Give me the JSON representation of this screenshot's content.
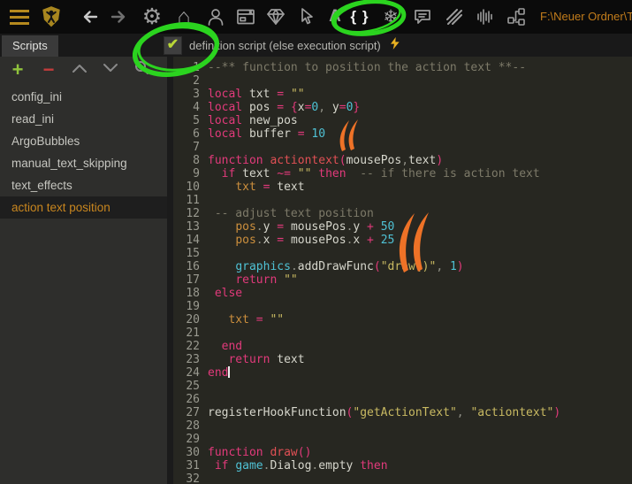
{
  "topbar": {
    "path": "F:\\Neuer Ordner\\T",
    "icons": {
      "gear": "⚙",
      "home": "⌂",
      "snowflake": "❄",
      "letter_a": "A",
      "braces": "{ }"
    }
  },
  "tabbar": {
    "tab_label": "Scripts",
    "checkbox_label": "definition script (else execution script)",
    "check_glyph": "✔",
    "checkbox_checked": true
  },
  "sidebar": {
    "tools": {
      "plus": "+",
      "minus": "−"
    },
    "items": [
      {
        "label": "config_ini",
        "selected": false
      },
      {
        "label": "read_ini",
        "selected": false
      },
      {
        "label": "ArgoBubbles",
        "selected": false
      },
      {
        "label": "manual_text_skipping",
        "selected": false
      },
      {
        "label": "text_effects",
        "selected": false
      },
      {
        "label": "action text position",
        "selected": true
      }
    ]
  },
  "editor": {
    "language": "lua",
    "lines": [
      {
        "n": 1,
        "t": [
          [
            "--** function to position the action text **--",
            "c"
          ]
        ]
      },
      {
        "n": 2,
        "t": []
      },
      {
        "n": 3,
        "t": [
          [
            "local ",
            "k"
          ],
          [
            "txt ",
            "i"
          ],
          [
            "= ",
            "k"
          ],
          [
            "\"\"",
            "s"
          ]
        ]
      },
      {
        "n": 4,
        "t": [
          [
            "local ",
            "k"
          ],
          [
            "pos ",
            "i"
          ],
          [
            "= ",
            "k"
          ],
          [
            "{",
            "k"
          ],
          [
            "x",
            "i"
          ],
          [
            "=",
            "k"
          ],
          [
            "0",
            "n"
          ],
          [
            ", ",
            "p"
          ],
          [
            "y",
            "i"
          ],
          [
            "=",
            "k"
          ],
          [
            "0",
            "n"
          ],
          [
            "}",
            "k"
          ]
        ]
      },
      {
        "n": 5,
        "t": [
          [
            "local ",
            "k"
          ],
          [
            "new_pos",
            "i"
          ]
        ]
      },
      {
        "n": 6,
        "t": [
          [
            "local ",
            "k"
          ],
          [
            "buffer ",
            "i"
          ],
          [
            "= ",
            "k"
          ],
          [
            "10",
            "n"
          ]
        ]
      },
      {
        "n": 7,
        "t": []
      },
      {
        "n": 8,
        "t": [
          [
            "function ",
            "k"
          ],
          [
            "actiontext",
            "f"
          ],
          [
            "(",
            "k"
          ],
          [
            "mousePos",
            "i"
          ],
          [
            ",",
            "p"
          ],
          [
            "text",
            "i"
          ],
          [
            ")",
            "k"
          ]
        ]
      },
      {
        "n": 9,
        "t": [
          [
            "  ",
            "w"
          ],
          [
            "if ",
            "k"
          ],
          [
            "text ",
            "i"
          ],
          [
            "~= ",
            "k"
          ],
          [
            "\"\" ",
            "s"
          ],
          [
            "then",
            "k"
          ],
          [
            "  -- if there is action text",
            "c"
          ]
        ]
      },
      {
        "n": 10,
        "t": [
          [
            "    ",
            "w"
          ],
          [
            "txt ",
            "g"
          ],
          [
            "= ",
            "k"
          ],
          [
            "text",
            "i"
          ]
        ]
      },
      {
        "n": 11,
        "t": []
      },
      {
        "n": 12,
        "t": [
          [
            " -- adjust text position",
            "c"
          ]
        ]
      },
      {
        "n": 13,
        "t": [
          [
            "    ",
            "w"
          ],
          [
            "pos",
            "g"
          ],
          [
            ".",
            "p"
          ],
          [
            "y ",
            "i"
          ],
          [
            "= ",
            "k"
          ],
          [
            "mousePos",
            "i"
          ],
          [
            ".",
            "p"
          ],
          [
            "y ",
            "i"
          ],
          [
            "+ ",
            "k"
          ],
          [
            "50",
            "n"
          ]
        ]
      },
      {
        "n": 14,
        "t": [
          [
            "    ",
            "w"
          ],
          [
            "pos",
            "g"
          ],
          [
            ".",
            "p"
          ],
          [
            "x ",
            "i"
          ],
          [
            "= ",
            "k"
          ],
          [
            "mousePos",
            "i"
          ],
          [
            ".",
            "p"
          ],
          [
            "x ",
            "i"
          ],
          [
            "+ ",
            "k"
          ],
          [
            "25",
            "n"
          ]
        ]
      },
      {
        "n": 15,
        "t": []
      },
      {
        "n": 16,
        "t": [
          [
            "    ",
            "w"
          ],
          [
            "graphics",
            "b"
          ],
          [
            ".",
            "p"
          ],
          [
            "addDrawFunc",
            "i"
          ],
          [
            "(",
            "k"
          ],
          [
            "\"draw()\"",
            "s"
          ],
          [
            ",",
            "p"
          ],
          [
            " ",
            "w"
          ],
          [
            "1",
            "n"
          ],
          [
            ")",
            "k"
          ]
        ]
      },
      {
        "n": 17,
        "t": [
          [
            "    ",
            "w"
          ],
          [
            "return ",
            "k"
          ],
          [
            "\"\"",
            "s"
          ]
        ]
      },
      {
        "n": 18,
        "t": [
          [
            " ",
            "w"
          ],
          [
            "else",
            "k"
          ]
        ]
      },
      {
        "n": 19,
        "t": []
      },
      {
        "n": 20,
        "t": [
          [
            "   ",
            "w"
          ],
          [
            "txt ",
            "g"
          ],
          [
            "= ",
            "k"
          ],
          [
            "\"\"",
            "s"
          ]
        ]
      },
      {
        "n": 21,
        "t": []
      },
      {
        "n": 22,
        "t": [
          [
            "  ",
            "w"
          ],
          [
            "end",
            "k"
          ]
        ]
      },
      {
        "n": 23,
        "t": [
          [
            "   ",
            "w"
          ],
          [
            "return ",
            "k"
          ],
          [
            "text",
            "i"
          ]
        ]
      },
      {
        "n": 24,
        "t": [
          [
            "end",
            "k"
          ]
        ],
        "cursor": true
      },
      {
        "n": 25,
        "t": []
      },
      {
        "n": 26,
        "t": []
      },
      {
        "n": 27,
        "t": [
          [
            "registerHookFunction",
            "i"
          ],
          [
            "(",
            "k"
          ],
          [
            "\"getActionText\"",
            "s"
          ],
          [
            ",",
            "p"
          ],
          [
            " ",
            "w"
          ],
          [
            "\"actiontext\"",
            "s"
          ],
          [
            ")",
            "k"
          ]
        ]
      },
      {
        "n": 28,
        "t": []
      },
      {
        "n": 29,
        "t": []
      },
      {
        "n": 30,
        "t": [
          [
            "function ",
            "k"
          ],
          [
            "draw",
            "f"
          ],
          [
            "()",
            "k"
          ]
        ]
      },
      {
        "n": 31,
        "t": [
          [
            " ",
            "w"
          ],
          [
            "if ",
            "k"
          ],
          [
            "game",
            "b"
          ],
          [
            ".",
            "p"
          ],
          [
            "Dialog",
            "i"
          ],
          [
            ".",
            "p"
          ],
          [
            "empty ",
            "i"
          ],
          [
            "then",
            "k"
          ]
        ]
      },
      {
        "n": 32,
        "t": []
      }
    ]
  },
  "colors": {
    "annotation_green": "#2bd41f",
    "annotation_orange": "#ee7227",
    "accent_gold": "#b5891e",
    "keyword_pink": "#e23a7b",
    "string_yellow": "#c9ba62",
    "number_cyan": "#4fc1d4",
    "comment_gray": "#7d7a69",
    "selected_item_orange": "#c8861f",
    "editor_bg": "#272721",
    "sidebar_bg": "#2e2e2c",
    "topbar_bg": "#0b0b0b"
  }
}
